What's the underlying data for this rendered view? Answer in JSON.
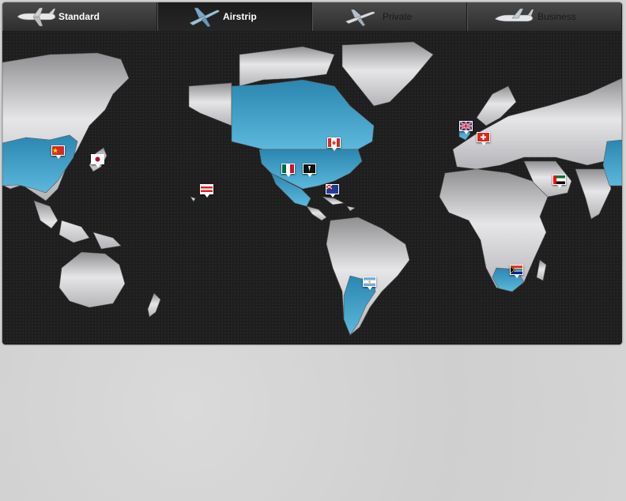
{
  "tabs": [
    {
      "label": "Standard",
      "icon": "airliner-icon"
    },
    {
      "label": "Airstrip",
      "icon": "small-jet-icon"
    },
    {
      "label": "Private",
      "icon": "private-jet-icon"
    },
    {
      "label": "Business",
      "icon": "business-jet-icon"
    }
  ],
  "active_tab": "Airstrip",
  "colors": {
    "highlight_land": "#3b9fc6",
    "land": "#c9c9cb",
    "ocean": "#1e1e1e",
    "page_bg": "#d3d3d3"
  },
  "map": {
    "highlighted_regions": [
      "China",
      "United States",
      "Canada",
      "Mexico",
      "Argentina",
      "South Africa",
      "United Kingdom"
    ],
    "flags": [
      {
        "name": "china-flag",
        "country": "China"
      },
      {
        "name": "japan-flag",
        "country": "Japan"
      },
      {
        "name": "hawaii-flag",
        "country": "Hawaii"
      },
      {
        "name": "canada-flag",
        "country": "Canada"
      },
      {
        "name": "mexico-flag",
        "country": "Mexico"
      },
      {
        "name": "black-flag",
        "country": "United States"
      },
      {
        "name": "caribbean-flag",
        "country": "Caribbean"
      },
      {
        "name": "argentina-flag",
        "country": "Argentina"
      },
      {
        "name": "uk-flag",
        "country": "United Kingdom"
      },
      {
        "name": "switzerland-flag",
        "country": "Switzerland"
      },
      {
        "name": "uae-flag",
        "country": "United Arab Emirates"
      },
      {
        "name": "south-africa-flag",
        "country": "South Africa"
      }
    ]
  }
}
